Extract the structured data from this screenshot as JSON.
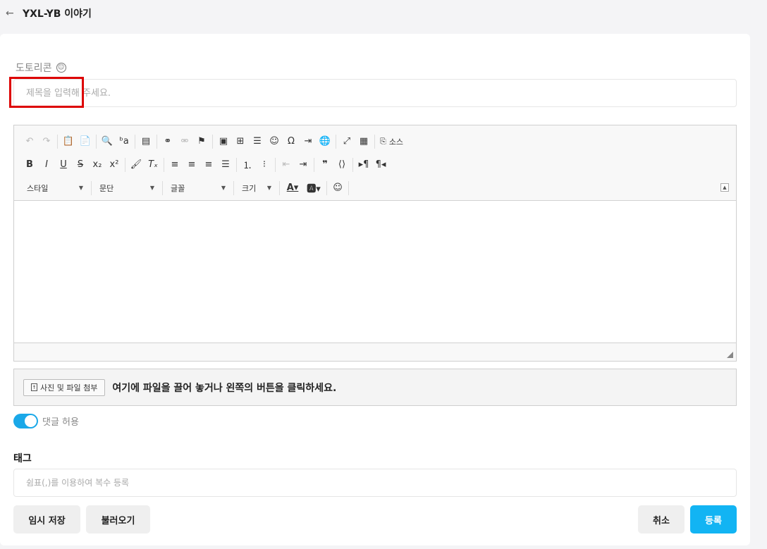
{
  "header": {
    "back_icon": "arrow-left-icon",
    "title": "YXL-YB 이야기"
  },
  "category": {
    "label": "도토리콘",
    "icon": "smile-icon"
  },
  "title_field": {
    "placeholder": "제목을 입력해 주세요."
  },
  "editor": {
    "combos": {
      "style": "스타일",
      "paragraph": "문단",
      "font": "글꼴",
      "size": "크기"
    },
    "source_label": "소스"
  },
  "attachment": {
    "button_label": "사진 및 파일 첨부",
    "hint": "여기에 파일을 끌어 놓거나 왼쪽의 버튼을 클릭하세요."
  },
  "comments": {
    "label": "댓글 허용",
    "enabled": true
  },
  "tags": {
    "title": "태그",
    "placeholder": "쉼표(,)를 이용하여 복수 등록"
  },
  "actions": {
    "temp_save": "임시 저장",
    "load": "불러오기",
    "cancel": "취소",
    "submit": "등록"
  },
  "colors": {
    "accent": "#12b4f3",
    "toggle": "#1aa8e8",
    "highlight_box": "#dd0000"
  }
}
